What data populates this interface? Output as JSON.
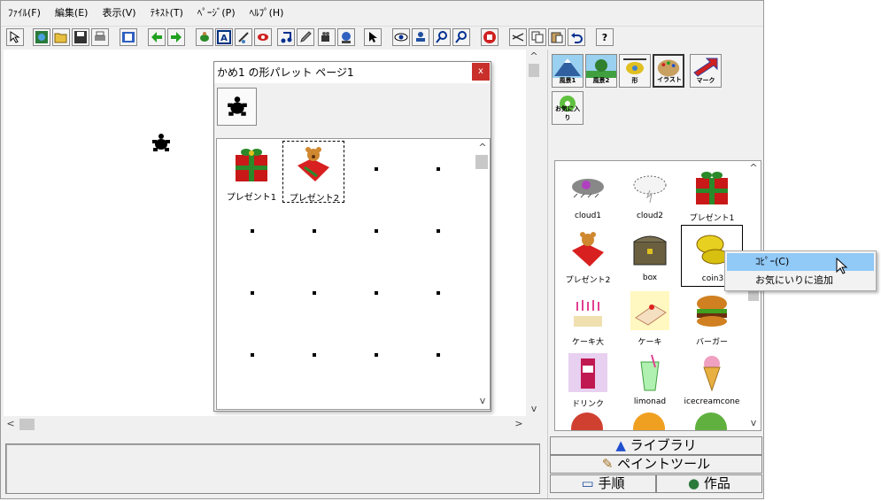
{
  "menu": [
    "ﾌｧｲﾙ(F)",
    "編集(E)",
    "表示(V)",
    "ﾃｷｽﾄ(T)",
    "ﾍﾟｰｼﾞ(P)",
    "ﾍﾙﾌﾟ(H)"
  ],
  "toolbar_question": "?",
  "palette": {
    "title": "かめ1 の形パレット ページ1",
    "close": "x",
    "items": [
      {
        "label": "プレゼント1",
        "icon": "gift-icon"
      },
      {
        "label": "プレゼント2",
        "icon": "gift-bear-icon"
      }
    ]
  },
  "categories": [
    {
      "label": "風景1",
      "icon": "mountain-icon"
    },
    {
      "label": "風景2",
      "icon": "landscape-icon"
    },
    {
      "label": "形",
      "icon": "helicopter-icon"
    },
    {
      "label": "イラスト",
      "icon": "palette-icon"
    },
    {
      "label": "マーク",
      "icon": "arrow-mark-icon"
    },
    {
      "label": "お気に入り",
      "icon": "favorite-icon"
    }
  ],
  "library": [
    {
      "label": "cloud1"
    },
    {
      "label": "cloud2"
    },
    {
      "label": "プレゼント1"
    },
    {
      "label": "プレゼント2"
    },
    {
      "label": "box"
    },
    {
      "label": "coin3"
    },
    {
      "label": "ケーキ大"
    },
    {
      "label": "ケーキ"
    },
    {
      "label": "バーガー"
    },
    {
      "label": "ドリンク"
    },
    {
      "label": "limonad"
    },
    {
      "label": "icecreamcone"
    }
  ],
  "tabs": {
    "library": "ライブラリ",
    "paint": "ペイントツール",
    "procedure": "手順",
    "works": "作品"
  },
  "context_menu": [
    "ｺﾋﾟｰ(C)",
    "お気にいりに追加"
  ]
}
